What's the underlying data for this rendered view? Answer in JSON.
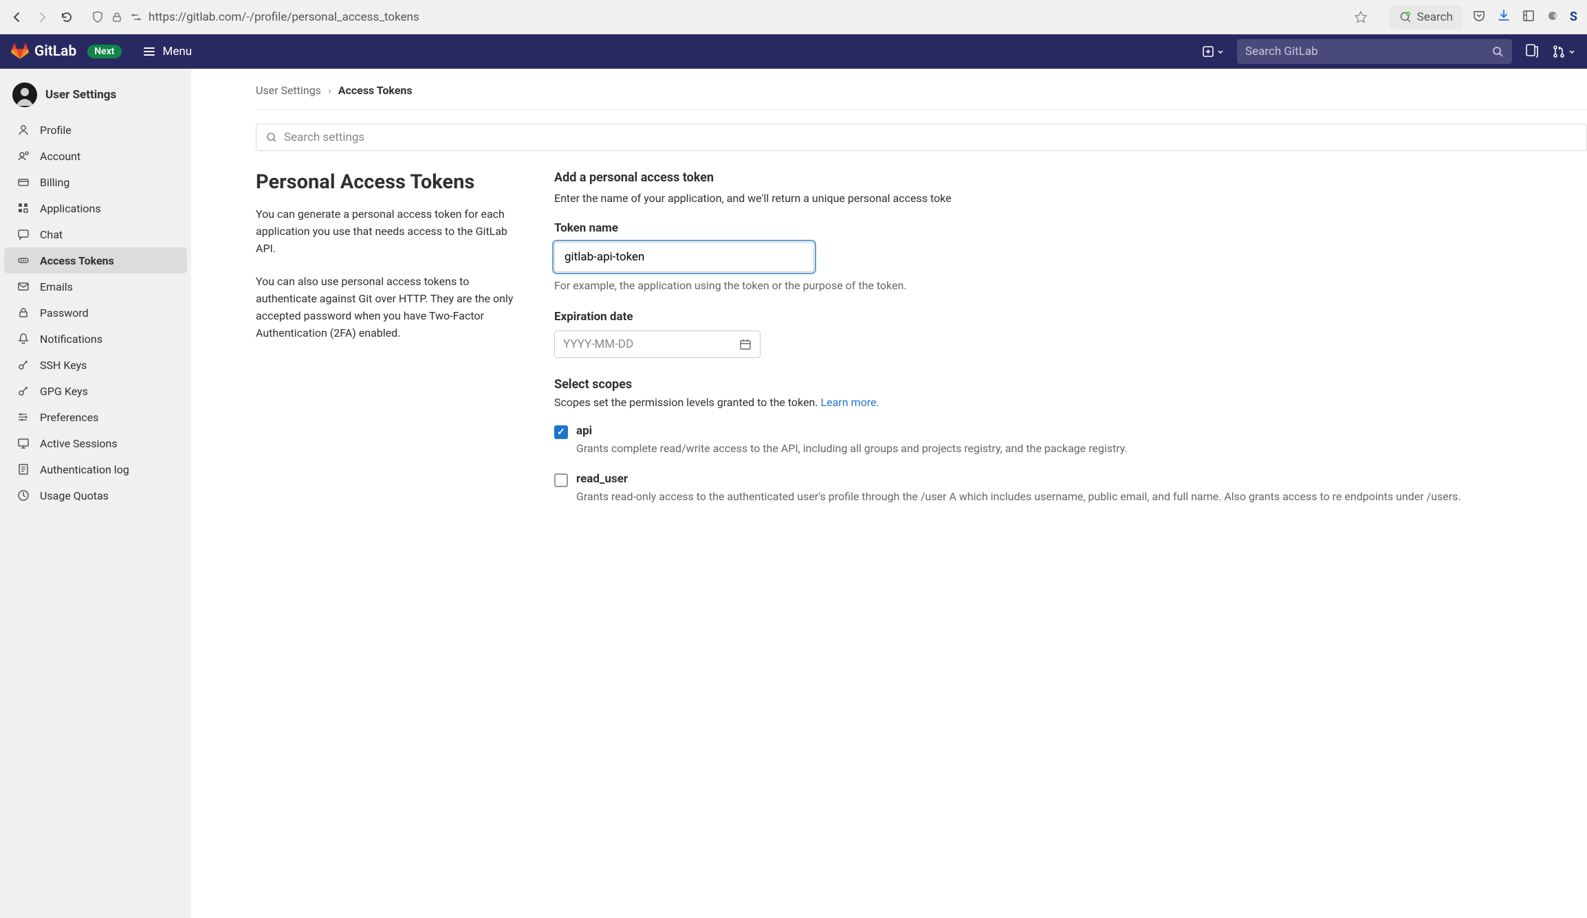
{
  "browser": {
    "url": "https://gitlab.com/-/profile/personal_access_tokens",
    "search_label": "Search",
    "profile_initial": "S"
  },
  "topnav": {
    "brand": "GitLab",
    "next_badge": "Next",
    "menu_label": "Menu",
    "search_placeholder": "Search GitLab"
  },
  "sidebar": {
    "title": "User Settings",
    "items": [
      {
        "icon": "profile",
        "label": "Profile"
      },
      {
        "icon": "account",
        "label": "Account"
      },
      {
        "icon": "billing",
        "label": "Billing"
      },
      {
        "icon": "apps",
        "label": "Applications"
      },
      {
        "icon": "chat",
        "label": "Chat"
      },
      {
        "icon": "token",
        "label": "Access Tokens"
      },
      {
        "icon": "email",
        "label": "Emails"
      },
      {
        "icon": "lock",
        "label": "Password"
      },
      {
        "icon": "bell",
        "label": "Notifications"
      },
      {
        "icon": "key",
        "label": "SSH Keys"
      },
      {
        "icon": "key",
        "label": "GPG Keys"
      },
      {
        "icon": "prefs",
        "label": "Preferences"
      },
      {
        "icon": "sessions",
        "label": "Active Sessions"
      },
      {
        "icon": "log",
        "label": "Authentication log"
      },
      {
        "icon": "quota",
        "label": "Usage Quotas"
      }
    ],
    "active_index": 5
  },
  "breadcrumb": {
    "parent": "User Settings",
    "current": "Access Tokens"
  },
  "search_settings_placeholder": "Search settings",
  "left_col": {
    "heading": "Personal Access Tokens",
    "p1": "You can generate a personal access token for each application you use that needs access to the GitLab API.",
    "p2": "You can also use personal access tokens to authenticate against Git over HTTP. They are the only accepted password when you have Two-Factor Authentication (2FA) enabled."
  },
  "form": {
    "title": "Add a personal access token",
    "subtitle": "Enter the name of your application, and we'll return a unique personal access toke",
    "token_name_label": "Token name",
    "token_name_value": "gitlab-api-token",
    "token_name_help": "For example, the application using the token or the purpose of the token.",
    "expiration_label": "Expiration date",
    "expiration_placeholder": "YYYY-MM-DD",
    "scopes_title": "Select scopes",
    "scopes_desc": "Scopes set the permission levels granted to the token. ",
    "scopes_learn_more": "Learn more.",
    "scopes": [
      {
        "key": "api",
        "checked": true,
        "desc": "Grants complete read/write access to the API, including all groups and projects registry, and the package registry."
      },
      {
        "key": "read_user",
        "checked": false,
        "desc": "Grants read-only access to the authenticated user's profile through the /user A which includes username, public email, and full name. Also grants access to re endpoints under /users."
      }
    ]
  }
}
